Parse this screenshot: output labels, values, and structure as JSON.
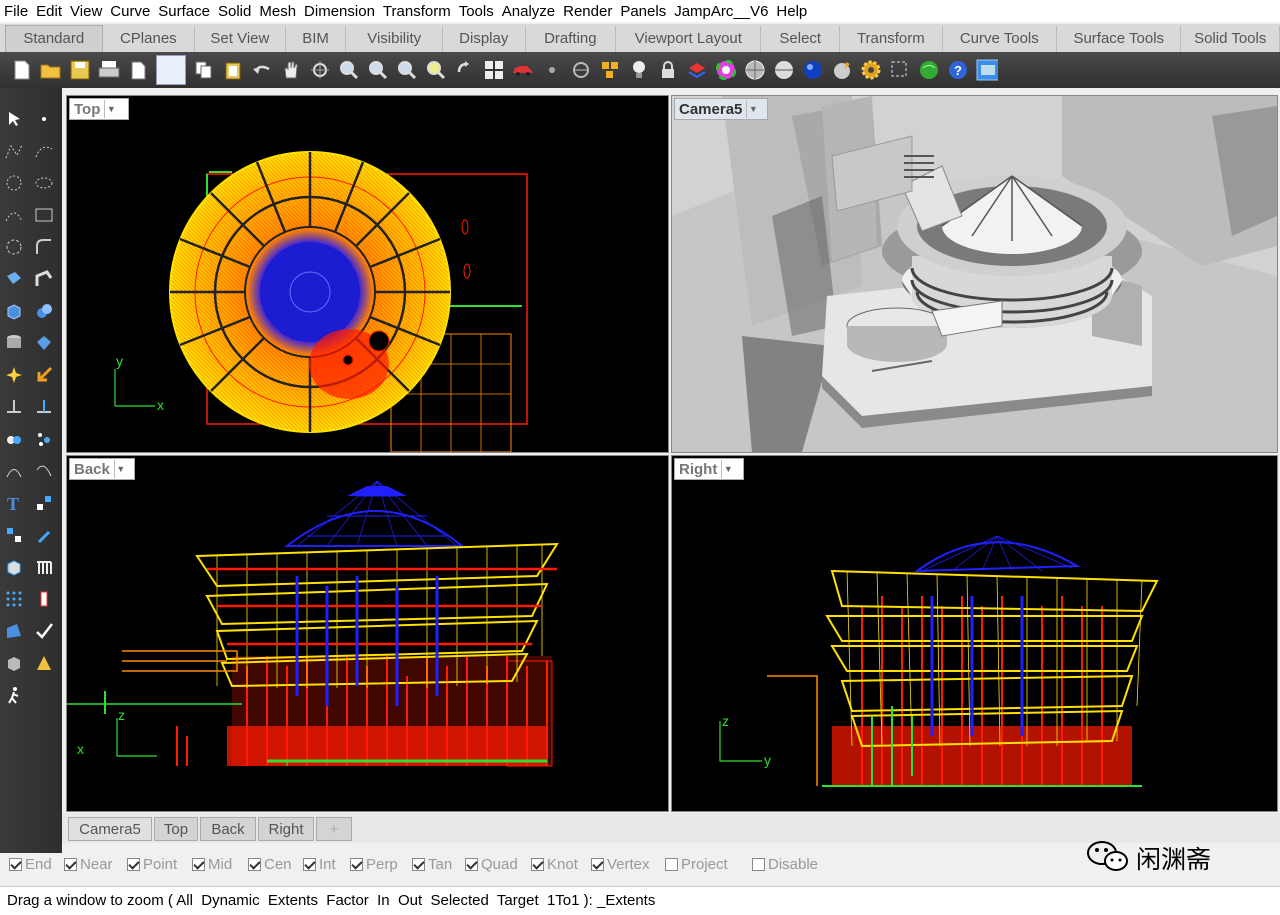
{
  "menu": [
    "File",
    "Edit",
    "View",
    "Curve",
    "Surface",
    "Solid",
    "Mesh",
    "Dimension",
    "Transform",
    "Tools",
    "Analyze",
    "Render",
    "Panels",
    "JampArc__V6",
    "Help"
  ],
  "toolbar_tabs": [
    {
      "label": "Standard",
      "active": true
    },
    {
      "label": "CPlanes"
    },
    {
      "label": "Set View"
    },
    {
      "label": "BIM"
    },
    {
      "label": "Visibility"
    },
    {
      "label": "Display"
    },
    {
      "label": "Drafting"
    },
    {
      "label": "Viewport Layout"
    },
    {
      "label": "Select"
    },
    {
      "label": "Transform"
    },
    {
      "label": "Curve Tools"
    },
    {
      "label": "Surface Tools"
    },
    {
      "label": "Solid Tools"
    }
  ],
  "toolbar_icons": [
    "new-file-icon",
    "open-folder-icon",
    "save-icon",
    "print-icon",
    "import-icon",
    "blank-icon",
    "copy-icon",
    "paste-icon",
    "undo-icon",
    "pan-hand-icon",
    "rotate-icon",
    "zoom-icon",
    "zoom-window-icon",
    "zoom-extents-icon",
    "zoom-selected-icon",
    "rotate-view-icon",
    "four-viewports-icon",
    "car-icon",
    "point-icon",
    "line-icon",
    "group-icon",
    "light-bulb-icon",
    "lock-icon",
    "layer-icon",
    "color-wheel-icon",
    "sphere-grey-icon",
    "sphere-silver-icon",
    "sphere-blue-icon",
    "render-icon",
    "gear-icon",
    "select-box-icon",
    "globe-icon",
    "help-icon",
    "window-icon"
  ],
  "viewports": {
    "top": {
      "label": "Top"
    },
    "camera": {
      "label": "Camera5"
    },
    "back": {
      "label": "Back"
    },
    "right": {
      "label": "Right"
    }
  },
  "axis": {
    "top_y": "y",
    "top_x": "x",
    "back_z": "z",
    "back_x": "x",
    "right_z": "z",
    "right_y": "y"
  },
  "viewport_tabs": [
    {
      "label": "Camera5",
      "active": true
    },
    {
      "label": "Top"
    },
    {
      "label": "Back"
    },
    {
      "label": "Right"
    }
  ],
  "add_tab_icon": "plus-icon",
  "osnaps": [
    {
      "label": "End",
      "checked": true
    },
    {
      "label": "Near",
      "checked": true
    },
    {
      "label": "Point",
      "checked": true
    },
    {
      "label": "Mid",
      "checked": true
    },
    {
      "label": "Cen",
      "checked": true
    },
    {
      "label": "Int",
      "checked": true
    },
    {
      "label": "Perp",
      "checked": true
    },
    {
      "label": "Tan",
      "checked": true
    },
    {
      "label": "Quad",
      "checked": true
    },
    {
      "label": "Knot",
      "checked": true
    },
    {
      "label": "Vertex",
      "checked": true
    },
    {
      "label": "Project",
      "checked": false
    },
    {
      "label": "Disable",
      "checked": false
    }
  ],
  "command_line": "Drag a window to zoom ( All  Dynamic  Extents  Factor  In  Out  Selected  Target  1To1 ): _Extents",
  "watermark": {
    "text": "闲渊斋",
    "icon": "wechat-icon"
  },
  "colors": {
    "wire_yellow": "#ffe000",
    "wire_orange": "#ff8a00",
    "wire_red": "#ff1a00",
    "wire_blue": "#2020ff",
    "wire_green": "#30e030"
  }
}
